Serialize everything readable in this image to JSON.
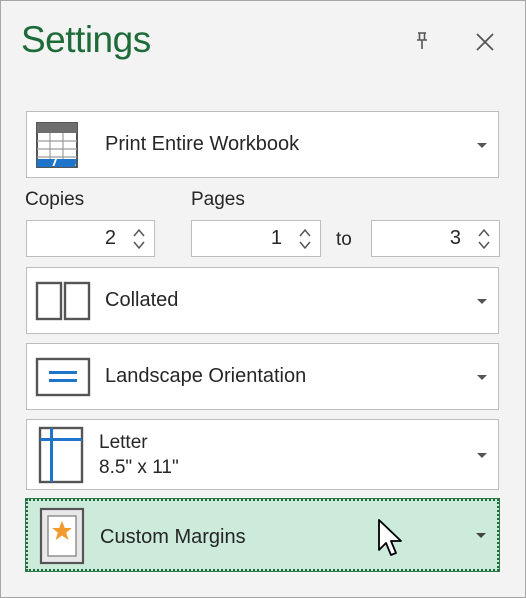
{
  "header": {
    "title": "Settings",
    "pin_icon": "pin-icon",
    "close_icon": "close-icon"
  },
  "print_what": {
    "label": "Print Entire Workbook",
    "icon": "workbook-icon"
  },
  "copies": {
    "label": "Copies",
    "value": "2"
  },
  "pages": {
    "label": "Pages",
    "from": "1",
    "to_label": "to",
    "to": "3"
  },
  "collation": {
    "label": "Collated",
    "icon": "collated-icon"
  },
  "orientation": {
    "label": "Landscape Orientation",
    "icon": "landscape-icon"
  },
  "paper": {
    "label": "Letter",
    "size": "8.5\" x 11\"",
    "icon": "paper-size-icon"
  },
  "margins": {
    "label": "Custom Margins",
    "icon": "custom-margins-icon"
  },
  "colors": {
    "accent": "#1e6b3a",
    "selected_bg": "#ccebdb",
    "icon_blue": "#1e74c8"
  }
}
